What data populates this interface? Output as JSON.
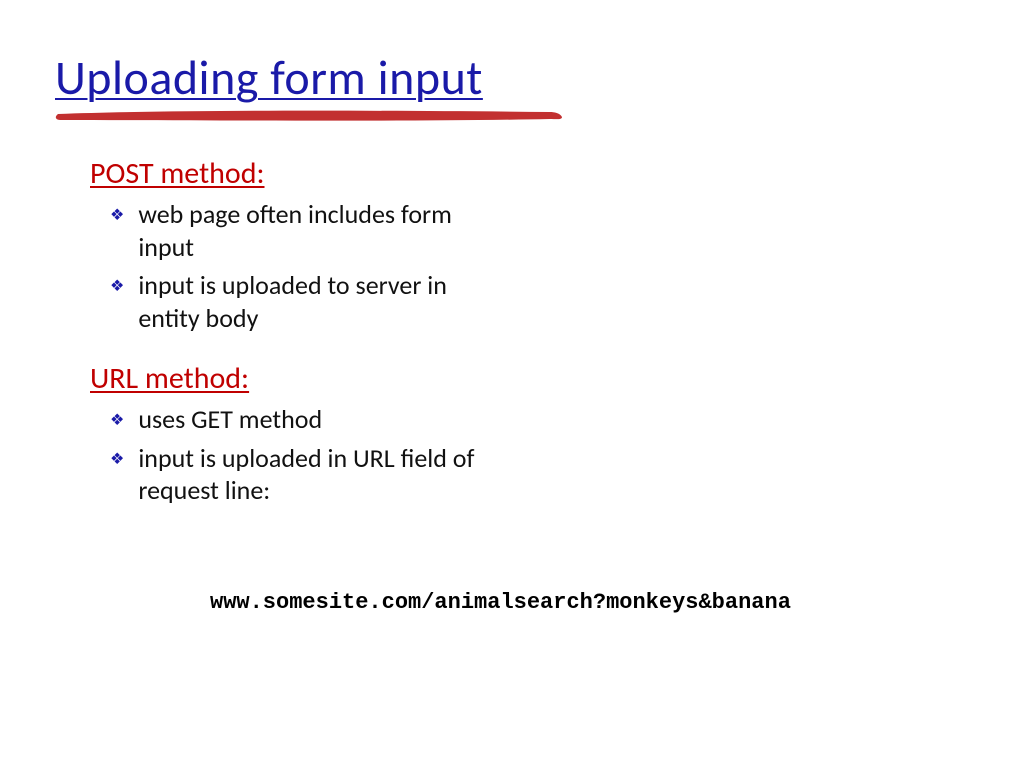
{
  "title": "Uploading form input",
  "sections": [
    {
      "heading": "POST method:",
      "bullets": [
        "web page often includes form input",
        "input is uploaded to server in entity body"
      ]
    },
    {
      "heading": "URL method:",
      "bullets": [
        "uses GET method",
        "input is uploaded in URL field of request line:"
      ]
    }
  ],
  "code": "www.somesite.com/animalsearch?monkeys&banana",
  "colors": {
    "title": "#1a1aa8",
    "underline_marker": "#c23030",
    "subhead": "#c00000",
    "bullet_icon": "#1a1aa8"
  }
}
